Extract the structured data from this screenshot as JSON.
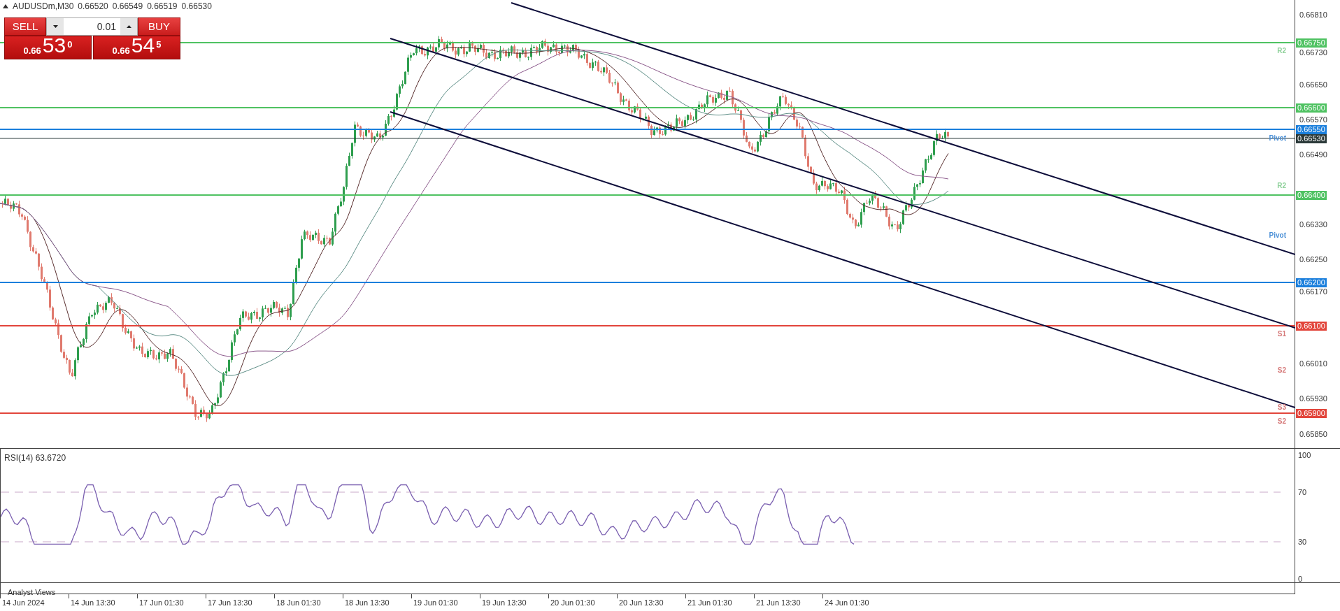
{
  "symbol_bar": {
    "symbol": "AUDUSDm,M30",
    "quotes": [
      "0.66520",
      "0.66549",
      "0.66519",
      "0.66530"
    ]
  },
  "trade_panel": {
    "volume": "0.01",
    "sell": {
      "label": "SELL",
      "prefix": "0.66",
      "digits": "53",
      "pip": "0"
    },
    "buy": {
      "label": "BUY",
      "prefix": "0.66",
      "digits": "54",
      "pip": "5"
    }
  },
  "price_axis": {
    "ticks": [
      "0.66810",
      "0.66730",
      "0.66650",
      "0.66570",
      "0.66490",
      "0.66330",
      "0.66250",
      "0.66170",
      "0.66010",
      "0.65930",
      "0.65850"
    ]
  },
  "levels": [
    {
      "price": "0.66750",
      "color": "#4fc262",
      "kind": "line"
    },
    {
      "price": "0.66600",
      "color": "#4fc262",
      "kind": "line"
    },
    {
      "price": "0.66550",
      "color": "#1b7fdc",
      "kind": "line"
    },
    {
      "price": "0.66530",
      "color": "#2c3a3a",
      "kind": "current"
    },
    {
      "price": "0.66400",
      "color": "#4fc262",
      "kind": "line"
    },
    {
      "price": "0.66200",
      "color": "#1b7fdc",
      "kind": "line"
    },
    {
      "price": "0.66100",
      "color": "#e2453b",
      "kind": "line"
    },
    {
      "price": "0.65900",
      "color": "#e2453b",
      "kind": "line"
    }
  ],
  "pivot_tags": [
    {
      "text": "R2",
      "color": "#8fd19b"
    },
    {
      "text": "Pivot",
      "color": "#4a8fd6"
    },
    {
      "text": "R2",
      "color": "#8fd19b"
    },
    {
      "text": "Pivot",
      "color": "#4a8fd6"
    },
    {
      "text": "S1",
      "color": "#d67a7a"
    },
    {
      "text": "S2",
      "color": "#d67a7a"
    },
    {
      "text": "S3",
      "color": "#d67a7a"
    },
    {
      "text": "S2",
      "color": "#d67a7a"
    }
  ],
  "rsi": {
    "title": "RSI(14) 63.6720",
    "ticks": [
      "100",
      "70",
      "30",
      "0"
    ]
  },
  "bottom_tab": "Analyst Views",
  "time_axis": [
    "14 Jun 2024",
    "14 Jun 13:30",
    "17 Jun 01:30",
    "17 Jun 13:30",
    "18 Jun 01:30",
    "18 Jun 13:30",
    "19 Jun 01:30",
    "19 Jun 13:30",
    "20 Jun 01:30",
    "20 Jun 13:30",
    "21 Jun 01:30",
    "21 Jun 13:30",
    "24 Jun 01:30"
  ]
}
